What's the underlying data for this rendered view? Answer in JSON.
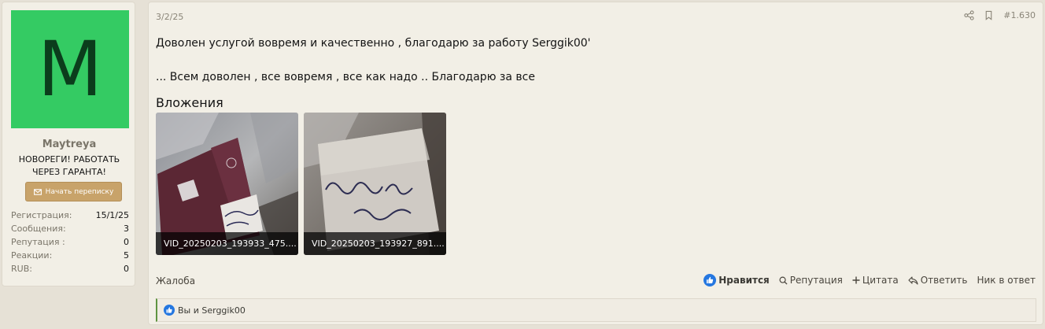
{
  "user": {
    "avatar_letter": "M",
    "avatar_color": "#34cb63",
    "name": "Maytreya",
    "title_line1": "НОВОРЕГИ! РАБОТАТЬ",
    "title_line2": "ЧЕРЕЗ ГАРАНТА!",
    "pm_button_label": "Начать переписку",
    "stats": [
      {
        "label": "Регистрация:",
        "value": "15/1/25"
      },
      {
        "label": "Сообщения:",
        "value": "3"
      },
      {
        "label": "Репутация :",
        "value": "0"
      },
      {
        "label": "Реакции:",
        "value": "5"
      },
      {
        "label": "RUB:",
        "value": "0"
      }
    ]
  },
  "post": {
    "date": "3/2/25",
    "number": "#1.630",
    "lines": [
      "Доволен услугой вовремя и качественно , благодарю за работу Serggik00'",
      "... Всем доволен , все вовремя , все как надо .. Благодарю за все"
    ],
    "attachments_title": "Вложения",
    "attachments": [
      {
        "caption": "VID_20250203_193933_475...."
      },
      {
        "caption": "VID_20250203_193927_891...."
      }
    ],
    "report_label": "Жалоба",
    "actions": {
      "like": "Нравится",
      "reputation": "Репутация",
      "quote": "Цитата",
      "reply": "Ответить",
      "nick": "Ник в ответ"
    },
    "reactions_text": "Вы и Serggik00"
  },
  "colors": {
    "accent_button": "#c8a36a",
    "like_blue": "#2577e0",
    "reaction_bar_accent": "#5f9441"
  }
}
